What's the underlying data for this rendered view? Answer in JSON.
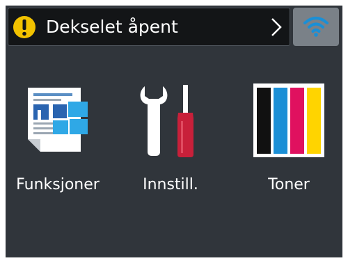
{
  "status_bar": {
    "message": "Dekselet åpent",
    "warning_color": "#f2c200",
    "warning_icon": "exclamation-warning-icon",
    "chevron_icon": "chevron-right-icon"
  },
  "wifi": {
    "icon": "wifi-icon",
    "color": "#1a8fd6"
  },
  "tiles": [
    {
      "label": "Funksjoner",
      "icon": "functions-document-icon"
    },
    {
      "label": "Innstill.",
      "icon": "settings-tools-icon"
    },
    {
      "label": "Toner",
      "icon": "toner-cartridges-icon"
    }
  ],
  "toner_colors": [
    "#111111",
    "#1a8fd6",
    "#e0115f",
    "#ffd400"
  ]
}
